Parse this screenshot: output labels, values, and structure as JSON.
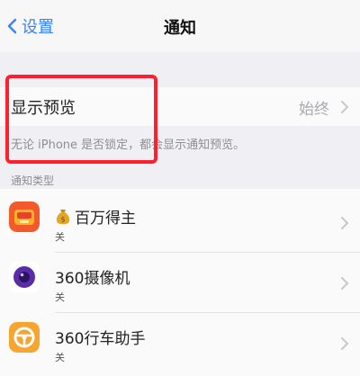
{
  "nav": {
    "back_label": "设置",
    "title": "通知"
  },
  "preview": {
    "label": "显示预览",
    "value": "始终",
    "footnote": "无论 iPhone 是否锁定，都会显示通知预览。"
  },
  "apps_section": {
    "header": "通知类型",
    "items": [
      {
        "name": "百万得主",
        "status": "关",
        "icon": "baiwan-app-icon",
        "name_prefix_icon": "money-bag-icon"
      },
      {
        "name": "360摄像机",
        "status": "关",
        "icon": "360-camera-app-icon"
      },
      {
        "name": "360行车助手",
        "status": "关",
        "icon": "360-drive-assistant-app-icon"
      }
    ]
  },
  "colors": {
    "accent": "#3b82f6",
    "highlight": "#ff1f2e",
    "background": "#efeff4"
  }
}
